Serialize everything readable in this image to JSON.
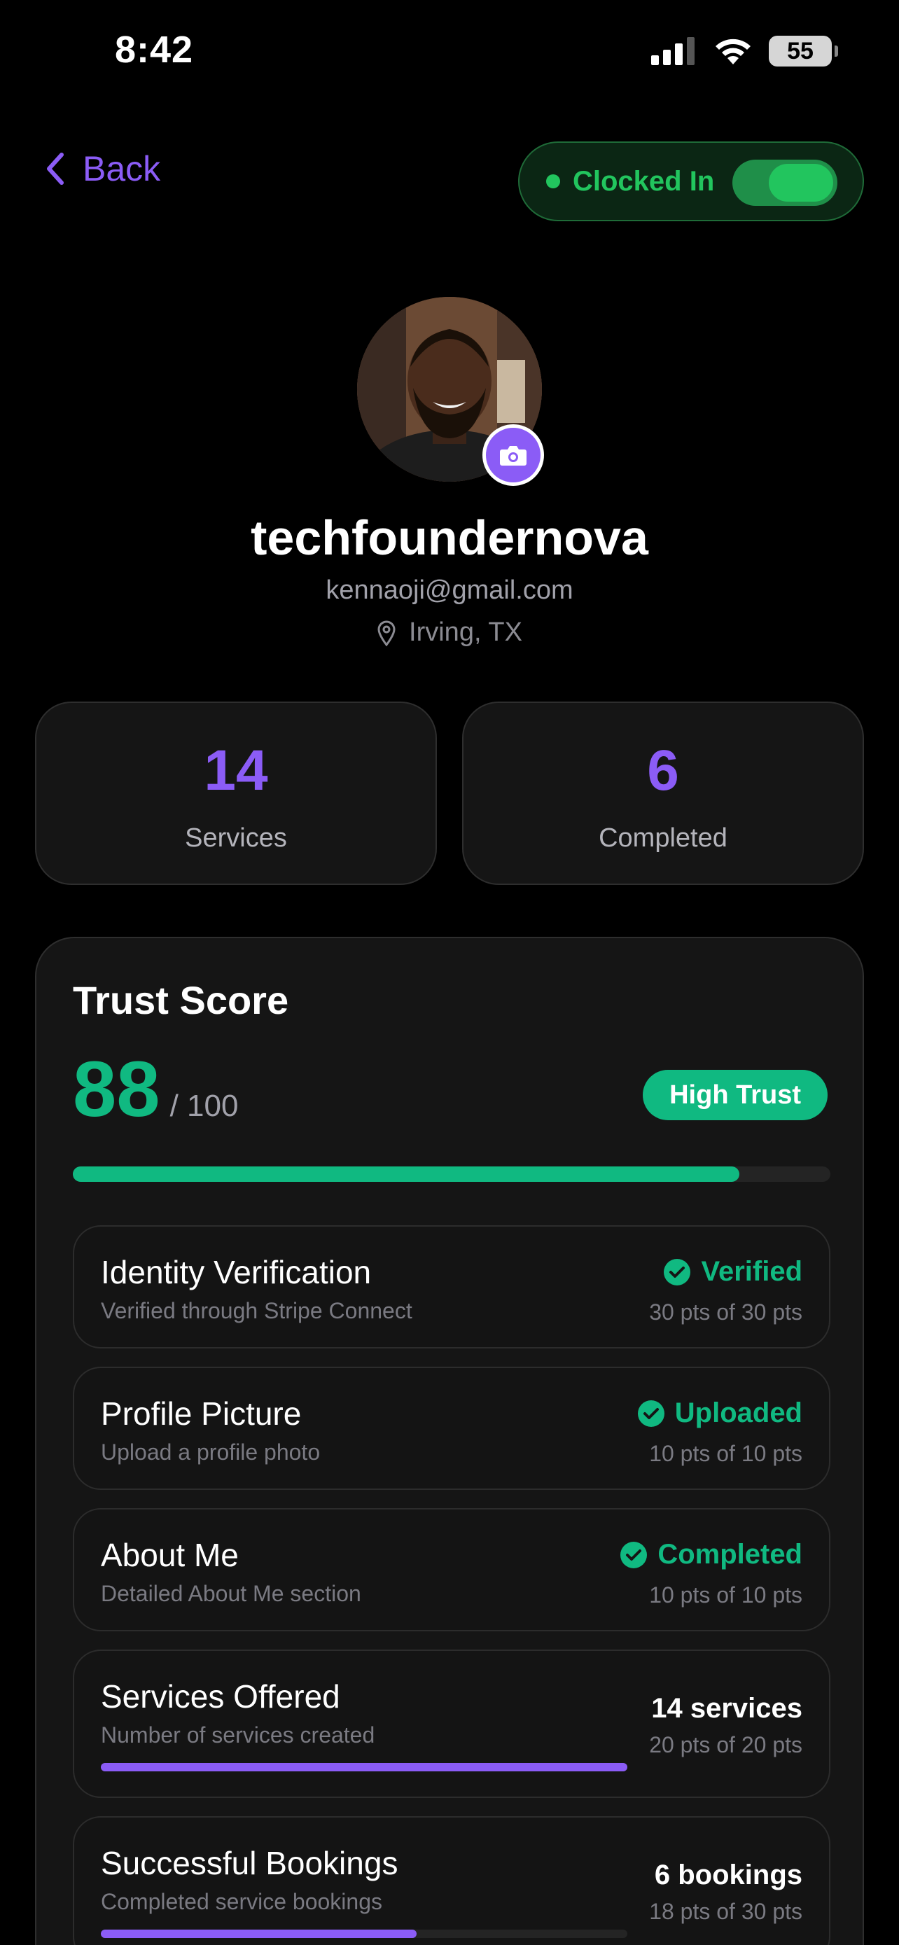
{
  "status_bar": {
    "time": "8:42",
    "battery": "55"
  },
  "nav": {
    "back_label": "Back",
    "clock_label": "Clocked In",
    "clock_on": true
  },
  "profile": {
    "username": "techfoundernova",
    "email": "kennaoji@gmail.com",
    "location": "Irving, TX"
  },
  "stats": [
    {
      "value": "14",
      "label": "Services"
    },
    {
      "value": "6",
      "label": "Completed"
    }
  ],
  "trust": {
    "title": "Trust Score",
    "score": "88",
    "max": "/ 100",
    "score_fraction": 0.88,
    "badge": "High Trust",
    "items": [
      {
        "title": "Identity Verification",
        "desc": "Verified through Stripe Connect",
        "status": "Verified",
        "pts": "30 pts of 30 pts"
      },
      {
        "title": "Profile Picture",
        "desc": "Upload a profile photo",
        "status": "Uploaded",
        "pts": "10 pts of 10 pts"
      },
      {
        "title": "About Me",
        "desc": "Detailed About Me section",
        "status": "Completed",
        "pts": "10 pts of 10 pts"
      },
      {
        "title": "Services Offered",
        "desc": "Number of services created",
        "count": "14 services",
        "pts": "20 pts of 20 pts",
        "progress": 1.0
      },
      {
        "title": "Successful Bookings",
        "desc": "Completed service bookings",
        "count": "6 bookings",
        "pts": "18 pts of 30 pts",
        "progress": 0.6
      }
    ]
  },
  "colors": {
    "accent": "#8b5cf6",
    "success": "#10b981",
    "clock_green": "#22c55e",
    "background": "#000000",
    "card": "#151515"
  }
}
